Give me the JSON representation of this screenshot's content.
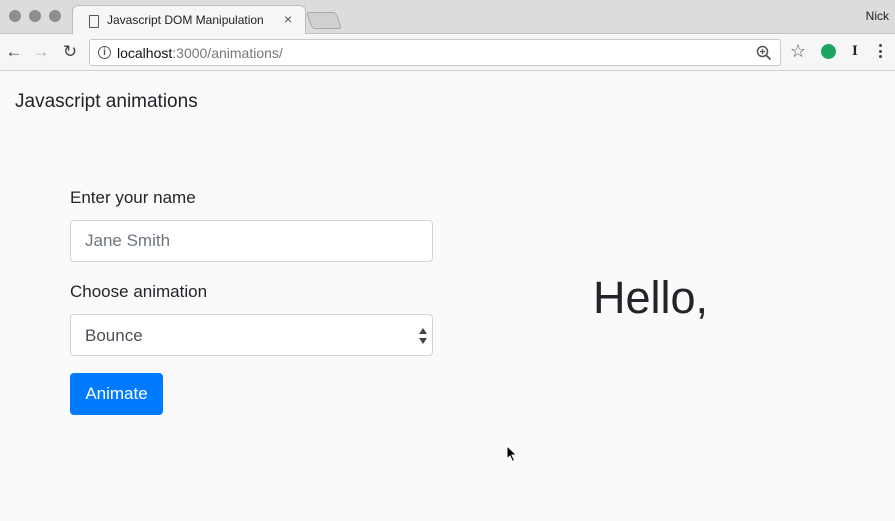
{
  "browser": {
    "tab_title": "Javascript DOM Manipulation",
    "tab_close": "×",
    "profile_name": "Nick",
    "url_host": "localhost",
    "url_path": ":3000/animations/",
    "nav": {
      "back": "←",
      "forward": "→",
      "reload": "↻"
    },
    "star": "☆",
    "extension_label": "I"
  },
  "page": {
    "title": "Javascript animations",
    "name_label": "Enter your name",
    "name_placeholder": "Jane Smith",
    "animation_label": "Choose animation",
    "animation_selected": "Bounce",
    "animate_button": "Animate",
    "greeting": "Hello,"
  },
  "colors": {
    "primary": "#007bff",
    "extension_green": "#1ba462",
    "traffic_light": "#8e8e8e"
  }
}
